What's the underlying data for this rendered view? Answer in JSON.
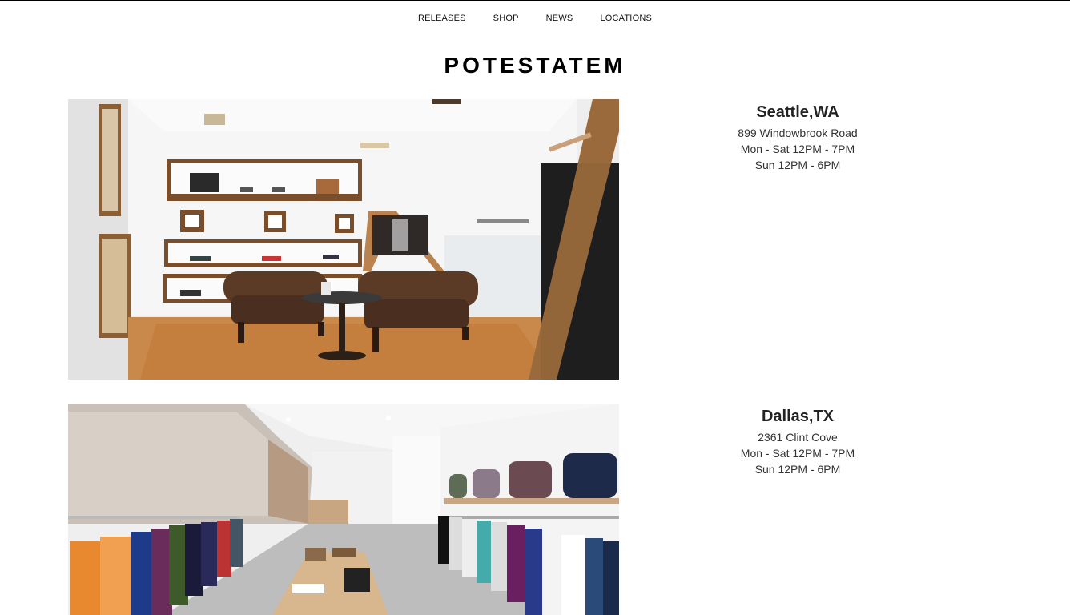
{
  "nav": {
    "items": [
      "RELEASES",
      "SHOP",
      "NEWS",
      "LOCATIONS"
    ]
  },
  "brand": {
    "title": "POTESTATEM"
  },
  "locations": [
    {
      "city": "Seattle,WA",
      "address": "899 Windowbrook Road",
      "weekday_hours": "Mon - Sat 12PM - 7PM",
      "sunday_hours": "Sun 12PM - 6PM"
    },
    {
      "city": "Dallas,TX",
      "address": "2361 Clint Cove",
      "weekday_hours": "Mon - Sat 12PM - 7PM",
      "sunday_hours": "Sun 12PM - 6PM"
    }
  ],
  "colors": {
    "text": "#333333",
    "wood": "#7a4e2a",
    "floor": "#c8894a",
    "leather": "#4a2e1f"
  }
}
